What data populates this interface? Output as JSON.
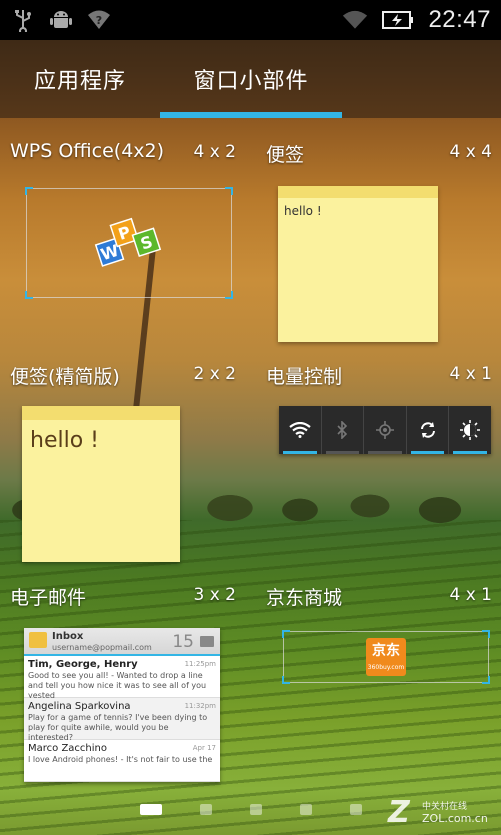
{
  "status_bar": {
    "time": "22:47",
    "icons": [
      "usb-icon",
      "android-debug-icon",
      "wifi-unknown-icon",
      "wifi-signal-icon",
      "battery-charging-icon"
    ]
  },
  "tabs": [
    {
      "label": "应用程序",
      "selected": false
    },
    {
      "label": "窗口小部件",
      "selected": true
    }
  ],
  "widgets": [
    {
      "name": "WPS Office(4x2)",
      "size": "4 x 2"
    },
    {
      "name": "便签",
      "size": "4 x 4",
      "preview_text": "hello !"
    },
    {
      "name": "便签(精简版)",
      "size": "2 x 2",
      "preview_text": "hello !"
    },
    {
      "name": "电量控制",
      "size": "4 x 1",
      "toggles": [
        {
          "icon": "wifi-icon",
          "on": true
        },
        {
          "icon": "bluetooth-icon",
          "on": false
        },
        {
          "icon": "gps-icon",
          "on": false
        },
        {
          "icon": "sync-icon",
          "on": true
        },
        {
          "icon": "brightness-icon",
          "on": true
        }
      ]
    },
    {
      "name": "电子邮件",
      "size": "3 x 2"
    },
    {
      "name": "京东商城",
      "size": "4 x 1"
    }
  ],
  "email_preview": {
    "title": "Inbox",
    "account": "username@popmail.com",
    "count": "15",
    "messages": [
      {
        "from": "Tim, George, Henry",
        "date": "11:25pm",
        "snippet": "Good to see you all! - Wanted to drop a line and tell you how nice it was to see all of you yested",
        "unread": true
      },
      {
        "from": "Angelina Sparkovina",
        "date": "11:32pm",
        "snippet": "Play for a game of tennis? I've been dying to play for quite awhile, would you be interested?",
        "unread": false
      },
      {
        "from": "Marco Zacchino",
        "date": "Apr 17",
        "snippet": "I love Android phones! - It's not fair to use the",
        "unread": false
      }
    ]
  },
  "jd_logo": {
    "main": "京东",
    "sub": "360buy.com"
  },
  "pager": {
    "count": 5,
    "active": 0
  },
  "watermark": {
    "brand": "Z",
    "cn": "中关村在线",
    "url": "ZOL.com.cn"
  },
  "colors": {
    "accent": "#33b5e5",
    "note_yellow": "#fbf29e",
    "jd_orange": "#f08a1c"
  }
}
